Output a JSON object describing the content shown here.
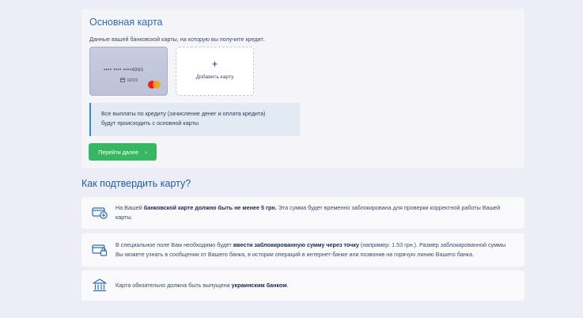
{
  "main_card": {
    "title": "Основная карта",
    "subtitle": "Данные вашей банковской карты, на которую вы получите кредит:",
    "card": {
      "masked_number": "•••• •••• ••••4960",
      "expiry": "02/19",
      "brand_icon": "mastercard-icon"
    },
    "add_card": {
      "plus": "+",
      "label": "Добавить карту"
    },
    "info": {
      "line1": "Все выплаты по кредиту (зачисление денег и оплата кредита)",
      "line2": "будут происходить с основной карты"
    },
    "next_button": {
      "label": "Перейти далее",
      "arrow": "›"
    }
  },
  "verify": {
    "title": "Как подтвердить карту?",
    "steps": [
      {
        "icon": "card-plus-icon",
        "pre": "На Вашей ",
        "bold": "банковской карте должно быть не менее 5 грн.",
        "post": " Эта сумма будет временно заблокирована для проверки корректной работы Вашей карты."
      },
      {
        "icon": "card-lock-icon",
        "pre": "В специальное поле Вам необходимо будет ",
        "bold": "ввести заблокированную сумму через точку",
        "post": " (например: 1.53 грн.). Размер заблокированной суммы Вы можете узнать в сообщении от Вашего банка, в истории операций в интернет-банке или позвонив на горячую линию Вашего банка."
      },
      {
        "icon": "bank-icon",
        "pre": "Карта обязательно должна быть выпущена ",
        "bold": "украинским банком",
        "post": "."
      }
    ]
  },
  "colors": {
    "accent_blue": "#2d6db0",
    "button_green": "#37b761",
    "info_border": "#2d8ad4",
    "page_bg": "#ecedf7"
  }
}
